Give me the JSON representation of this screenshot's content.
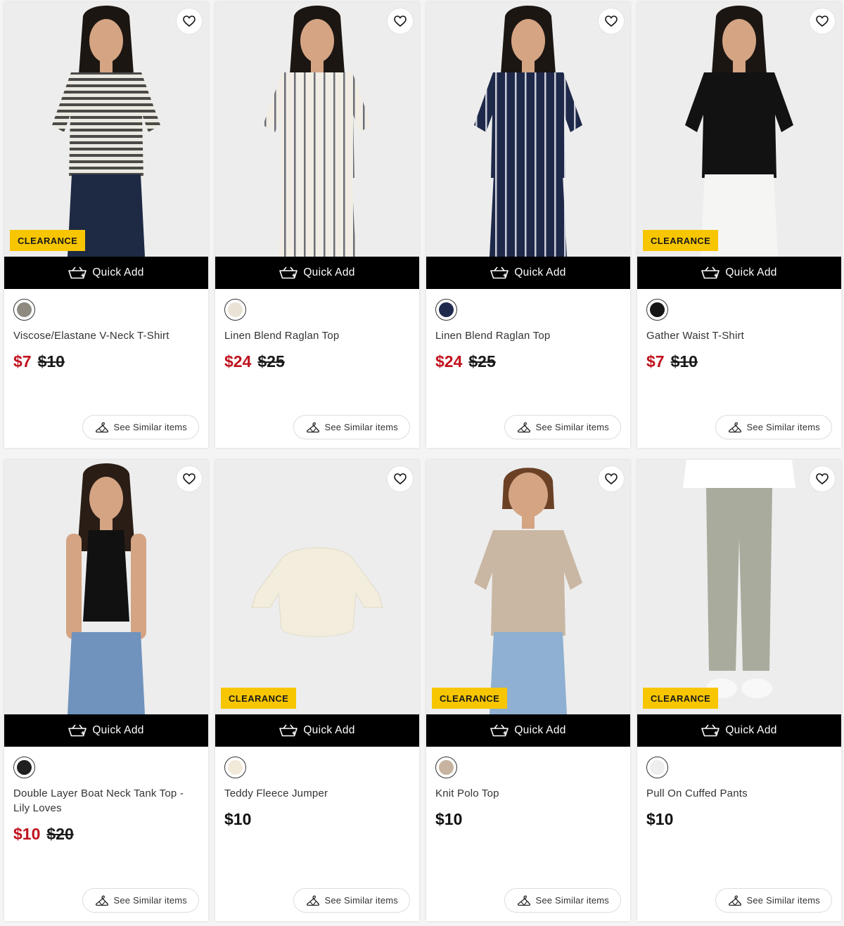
{
  "products": [
    {
      "name": "Viscose/Elastane V-Neck T-Shirt",
      "price_now": "$7",
      "price_was": "$10",
      "clearance": "CLEARANCE",
      "quick_add": "Quick Add",
      "see_similar": "See Similar items",
      "swatch_color": "#8e8a80",
      "photo": {
        "hair": "#1c1612",
        "top": "stripes-grey",
        "bottom": "#1e2a44"
      }
    },
    {
      "name": "Linen Blend Raglan Top",
      "price_now": "$24",
      "price_was": "$25",
      "clearance": "",
      "quick_add": "Quick Add",
      "see_similar": "See Similar items",
      "swatch_color": "#e9e3d6",
      "photo": {
        "hair": "#1c1612",
        "top": "stripes-cream",
        "bottom": "stripes-cream"
      }
    },
    {
      "name": "Linen Blend Raglan Top",
      "price_now": "$24",
      "price_was": "$25",
      "clearance": "",
      "quick_add": "Quick Add",
      "see_similar": "See Similar items",
      "swatch_color": "#1f2a4d",
      "photo": {
        "hair": "#1c1612",
        "top": "stripes-navy",
        "bottom": "stripes-navy"
      }
    },
    {
      "name": "Gather Waist T-Shirt",
      "price_now": "$7",
      "price_was": "$10",
      "clearance": "CLEARANCE",
      "quick_add": "Quick Add",
      "see_similar": "See Similar items",
      "swatch_color": "#151515",
      "photo": {
        "hair": "#1c1612",
        "top": "#121212",
        "bottom": "#f5f5f3"
      }
    },
    {
      "name": "Double Layer Boat Neck Tank Top - Lily Loves",
      "price_now": "$10",
      "price_was": "$20",
      "clearance": "",
      "quick_add": "Quick Add",
      "see_similar": "See Similar items",
      "swatch_color": "#202020",
      "photo": {
        "hair": "#2a1d16",
        "top": "#111111",
        "bottom": "#6f93bd"
      }
    },
    {
      "name": "Teddy Fleece Jumper",
      "price_now": "$10",
      "price_was": "",
      "clearance": "CLEARANCE",
      "quick_add": "Quick Add",
      "see_similar": "See Similar items",
      "swatch_color": "#f1ead8",
      "photo": {
        "hair": "",
        "top": "#f3eddd",
        "bottom": ""
      }
    },
    {
      "name": "Knit Polo Top",
      "price_now": "$10",
      "price_was": "",
      "clearance": "CLEARANCE",
      "quick_add": "Quick Add",
      "see_similar": "See Similar items",
      "swatch_color": "#c7b3a0",
      "photo": {
        "hair": "#6b4126",
        "top": "#c9b7a3",
        "bottom": "#8fb0d2"
      }
    },
    {
      "name": "Pull On Cuffed Pants",
      "price_now": "$10",
      "price_was": "",
      "clearance": "CLEARANCE",
      "quick_add": "Quick Add",
      "see_similar": "See Similar items",
      "swatch_color": "#eeeeee",
      "photo": {
        "hair": "",
        "top": "#ffffff",
        "bottom": "#a9ab9d"
      }
    }
  ],
  "colors": {
    "sale_price": "#c0121d",
    "clearance_badge": "#f7c600",
    "quick_add_bar": "#000000"
  }
}
